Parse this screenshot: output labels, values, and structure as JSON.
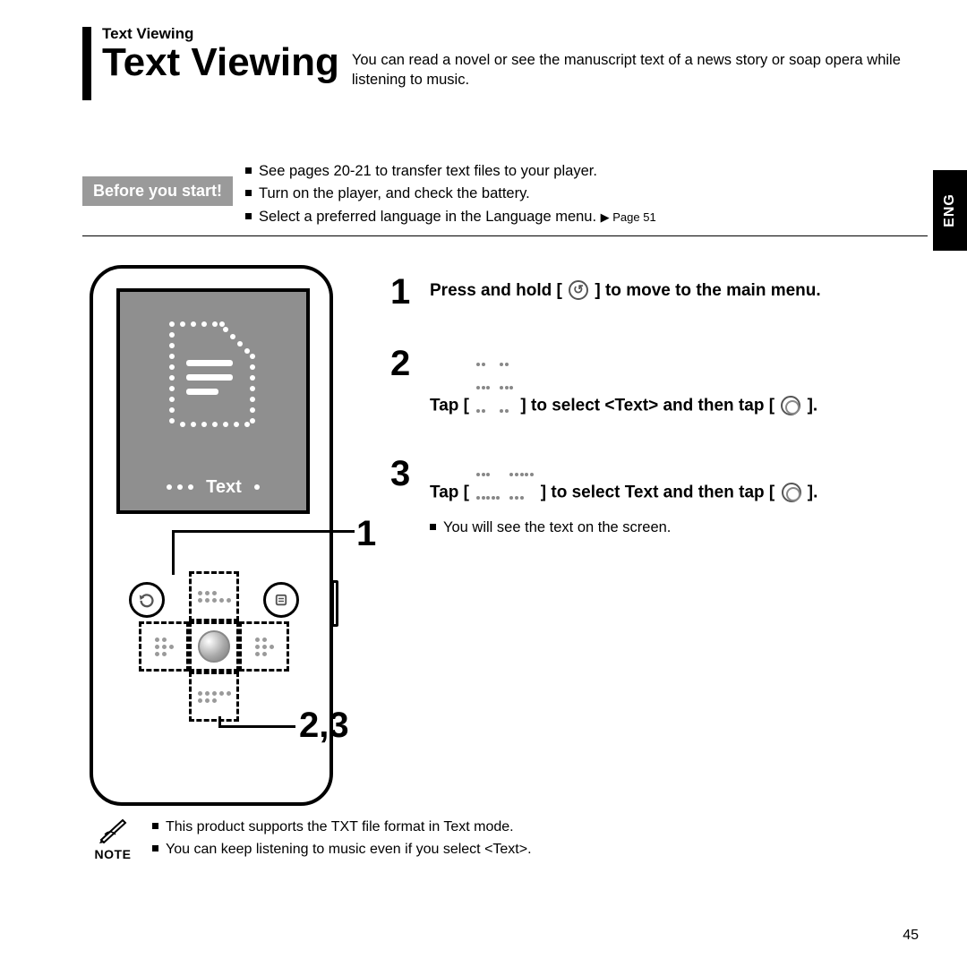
{
  "breadcrumb": "Text Viewing",
  "title": "Text Viewing",
  "subtitle": "You can read a novel or see the manuscript text of a news story or soap opera while listening to music.",
  "side_tab": "ENG",
  "before": {
    "label": "Before you start!",
    "items": [
      "See pages 20-21 to transfer text files to your player.",
      "Turn on the player, and check the battery.",
      "Select a preferred language in the Language menu."
    ],
    "page_ref": "▶ Page 51"
  },
  "device": {
    "screen_label": "Text",
    "callout_1": "1",
    "callout_23": "2,3"
  },
  "steps": [
    {
      "num": "1",
      "text_a": "Press and hold [",
      "text_b": "] to move to the main menu."
    },
    {
      "num": "2",
      "text_a": "Tap [",
      "text_b": "] to select <Text> and then tap [",
      "text_c": "]."
    },
    {
      "num": "3",
      "text_a": "Tap [",
      "text_b": "] to select Text and then tap [",
      "text_c": "].",
      "sub": "You will see the text on the screen."
    }
  ],
  "note": {
    "label": "NOTE",
    "items": [
      "This product supports the TXT file format in Text mode.",
      "You can keep listening to music even if you select <Text>."
    ]
  },
  "page_number": "45"
}
